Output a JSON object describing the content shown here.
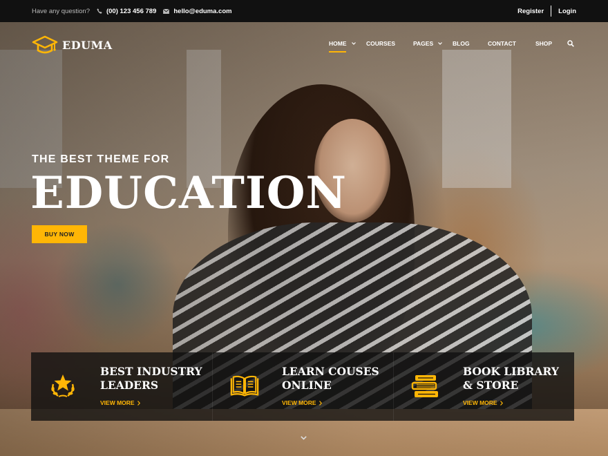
{
  "topbar": {
    "question": "Have any question?",
    "phone": "(00) 123 456 789",
    "email": "hello@eduma.com",
    "register_label": "Register",
    "login_label": "Login"
  },
  "logo": {
    "text": "EDUMA",
    "icon": "graduation-cap-icon"
  },
  "nav": {
    "items": [
      {
        "label": "HOME",
        "active": true,
        "has_dropdown": true
      },
      {
        "label": "COURSES",
        "active": false,
        "has_dropdown": false
      },
      {
        "label": "PAGES",
        "active": false,
        "has_dropdown": true
      },
      {
        "label": "BLOG",
        "active": false,
        "has_dropdown": false
      },
      {
        "label": "CONTACT",
        "active": false,
        "has_dropdown": false
      },
      {
        "label": "SHOP",
        "active": false,
        "has_dropdown": false
      }
    ],
    "search_icon": "search-icon"
  },
  "hero": {
    "subtitle": "THE BEST THEME FOR",
    "title": "EDUCATION",
    "button_label": "BUY NOW"
  },
  "features": [
    {
      "title_line1": "BEST INDUSTRY",
      "title_line2": "LEADERS",
      "link": "VIEW MORE",
      "icon": "star-laurel-icon"
    },
    {
      "title_line1": "LEARN COUSES",
      "title_line2": "ONLINE",
      "link": "VIEW MORE",
      "icon": "open-book-icon"
    },
    {
      "title_line1": "BOOK LIBRARY",
      "title_line2": "& STORE",
      "link": "VIEW MORE",
      "icon": "book-stack-icon"
    }
  ],
  "colors": {
    "accent": "#ffb606",
    "topbar_bg": "#111111"
  }
}
